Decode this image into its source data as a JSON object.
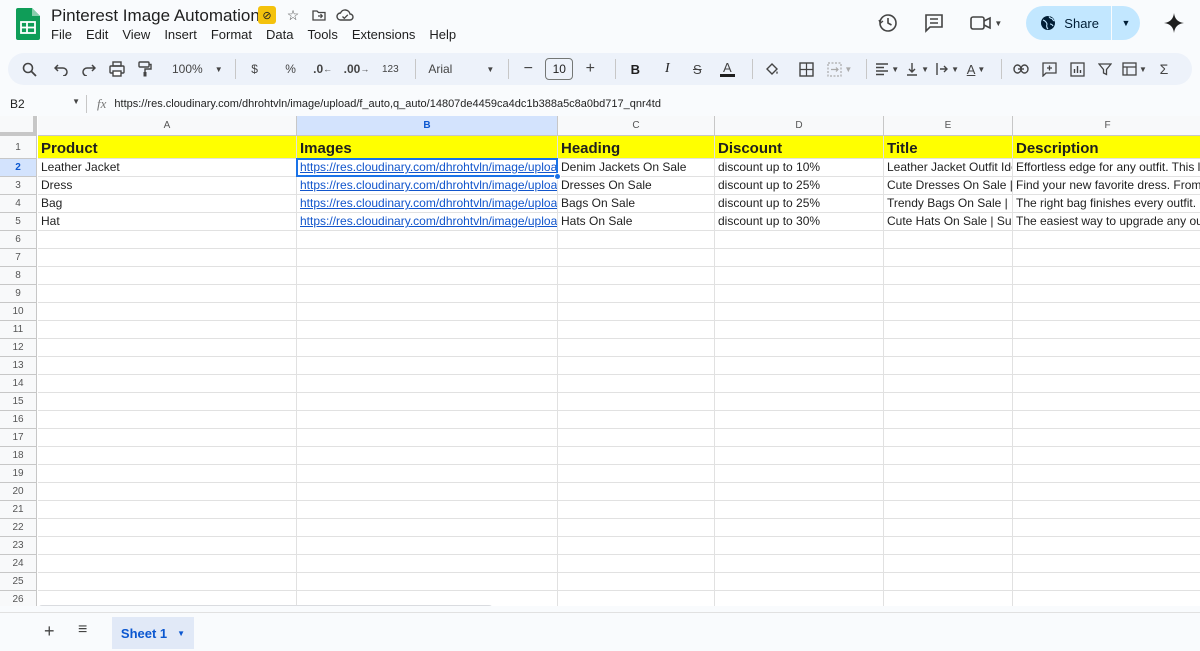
{
  "app": {
    "doc_title": "Pinterest Image Automation",
    "menu": [
      "File",
      "Edit",
      "View",
      "Insert",
      "Format",
      "Data",
      "Tools",
      "Extensions",
      "Help"
    ],
    "share_label": "Share"
  },
  "toolbar": {
    "zoom": "100%",
    "currency": "$",
    "percent": "%",
    "dec_decrease": ".0",
    "dec_increase": ".00",
    "number_format": "123",
    "font": "Arial",
    "font_size": "10",
    "bold": "B",
    "italic": "I",
    "strike": "S",
    "text_color": "A",
    "sum": "Σ"
  },
  "formula_bar": {
    "cell_ref": "B2",
    "content": "https://res.cloudinary.com/dhrohtvln/image/upload/f_auto,q_auto/14807de4459ca4dc1b388a5c8a0bd717_qnr4td"
  },
  "columns": [
    "A",
    "B",
    "C",
    "D",
    "E",
    "F"
  ],
  "selected_column": "B",
  "selected_row": 2,
  "row_numbers": [
    "1",
    "2",
    "3",
    "4",
    "5",
    "6",
    "7",
    "8",
    "9",
    "10",
    "11",
    "12",
    "13",
    "14",
    "15",
    "16",
    "17",
    "18",
    "19",
    "20",
    "21",
    "22",
    "23",
    "24",
    "25",
    "26"
  ],
  "header_row": [
    "Product",
    "Images",
    "Heading",
    "Discount",
    "Title",
    "Description"
  ],
  "data_rows": [
    [
      "Leather Jacket",
      "https://res.cloudinary.com/dhrohtvln/image/upload/f",
      "Denim Jackets On Sale",
      "discount up to 10%",
      "Leather Jacket Outfit Ide",
      "Effortless edge for any outfit. This le"
    ],
    [
      "Dress",
      "https://res.cloudinary.com/dhrohtvln/image/upload/f",
      "Dresses On Sale",
      "discount up to 25%",
      "Cute Dresses On Sale | (",
      "Find your new favorite dress. From d"
    ],
    [
      "Bag",
      "https://res.cloudinary.com/dhrohtvln/image/upload/f",
      "Bags On Sale",
      "discount up to 25%",
      "Trendy Bags On Sale | H",
      "The right bag finishes every outfit. D"
    ],
    [
      "Hat",
      "https://res.cloudinary.com/dhrohtvln/image/upload/f",
      "Hats On Sale",
      "discount up to 30%",
      "Cute Hats On Sale | Sum",
      "The easiest way to upgrade any outf"
    ]
  ],
  "sheet_tab": "Sheet 1",
  "colors": {
    "header_fill": "#ffff00",
    "link": "#1155cc",
    "accent": "#1a73e8",
    "share_bg": "#c2e7ff"
  }
}
